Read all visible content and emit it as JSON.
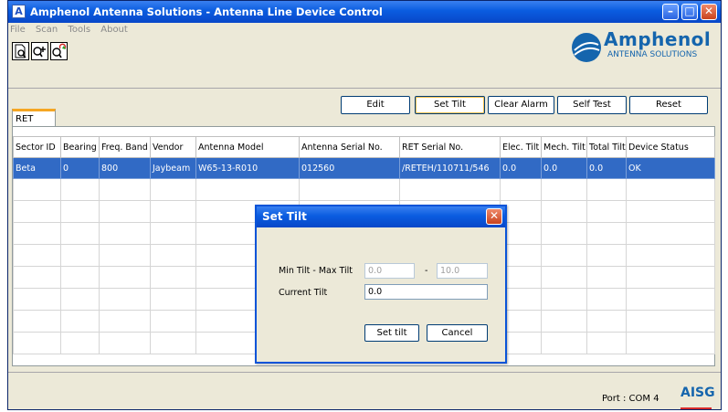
{
  "window": {
    "title": "Amphenol Antenna Solutions - Antenna Line Device Control",
    "app_icon_letter": "A"
  },
  "menu": [
    "File",
    "Scan",
    "Tools",
    "About"
  ],
  "toolbar": {
    "icons": [
      "preview-icon",
      "zoom-in-icon",
      "refresh-search-icon"
    ]
  },
  "logo": {
    "name": "Amphenol",
    "subtitle": "ANTENNA SOLUTIONS"
  },
  "actions": {
    "edit": "Edit",
    "set_tilt": "Set Tilt",
    "clear_alarm": "Clear Alarm",
    "self_test": "Self Test",
    "reset": "Reset"
  },
  "tabs": [
    {
      "label": "RET"
    }
  ],
  "grid": {
    "columns": [
      "Sector ID",
      "Bearing",
      "Freq. Band",
      "Vendor",
      "Antenna Model",
      "Antenna Serial No.",
      "RET Serial No.",
      "Elec. Tilt",
      "Mech. Tilt",
      "Total Tilt",
      "Device Status"
    ],
    "rows": [
      [
        "Beta",
        "0",
        "800",
        "Jaybeam",
        "W65-13-R010",
        "012560",
        "/RETEH/110711/546",
        "0.0",
        "0.0",
        "0.0",
        "OK"
      ]
    ]
  },
  "status": {
    "port": "Port : COM 4",
    "aisg_logo": "AISG"
  },
  "dialog": {
    "title": "Set Tilt",
    "min_max_label": "Min Tilt - Max Tilt",
    "min_value": "0.0",
    "separator": "-",
    "max_value": "10.0",
    "current_label": "Current Tilt",
    "current_value": "0.0",
    "set_button": "Set tilt",
    "cancel_button": "Cancel"
  },
  "colors": {
    "title_bar": "#0a5ce0",
    "selection": "#316ac5",
    "brand": "#1565ad"
  }
}
